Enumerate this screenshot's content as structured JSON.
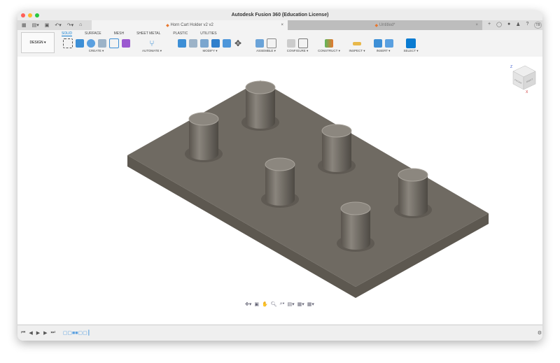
{
  "window": {
    "title": "Autodesk Fusion 360 (Education License)"
  },
  "tabs": [
    {
      "label": "Horn Cart Holder v2 v2",
      "active": true
    },
    {
      "label": "Untitled*",
      "active": false
    }
  ],
  "user": {
    "initials": "TB"
  },
  "workspace": {
    "label": "DESIGN ▾"
  },
  "ribbon_tabs": [
    "SOLID",
    "SURFACE",
    "MESH",
    "SHEET METAL",
    "PLASTIC",
    "UTILITIES"
  ],
  "groups": [
    {
      "label": "CREATE ▾"
    },
    {
      "label": "AUTOMATE ▾"
    },
    {
      "label": "MODIFY ▾"
    },
    {
      "label": "ASSEMBLE ▾"
    },
    {
      "label": "CONFIGURE ▾"
    },
    {
      "label": "CONSTRUCT ▾"
    },
    {
      "label": "INSPECT ▾"
    },
    {
      "label": "INSERT ▾"
    },
    {
      "label": "SELECT ▾"
    }
  ],
  "viewcube": {
    "labels": [
      "Z",
      "X",
      "FRONT",
      "RIGHT"
    ]
  },
  "colors": {
    "accent": "#0a7bd1",
    "model": "#6f6a62"
  }
}
